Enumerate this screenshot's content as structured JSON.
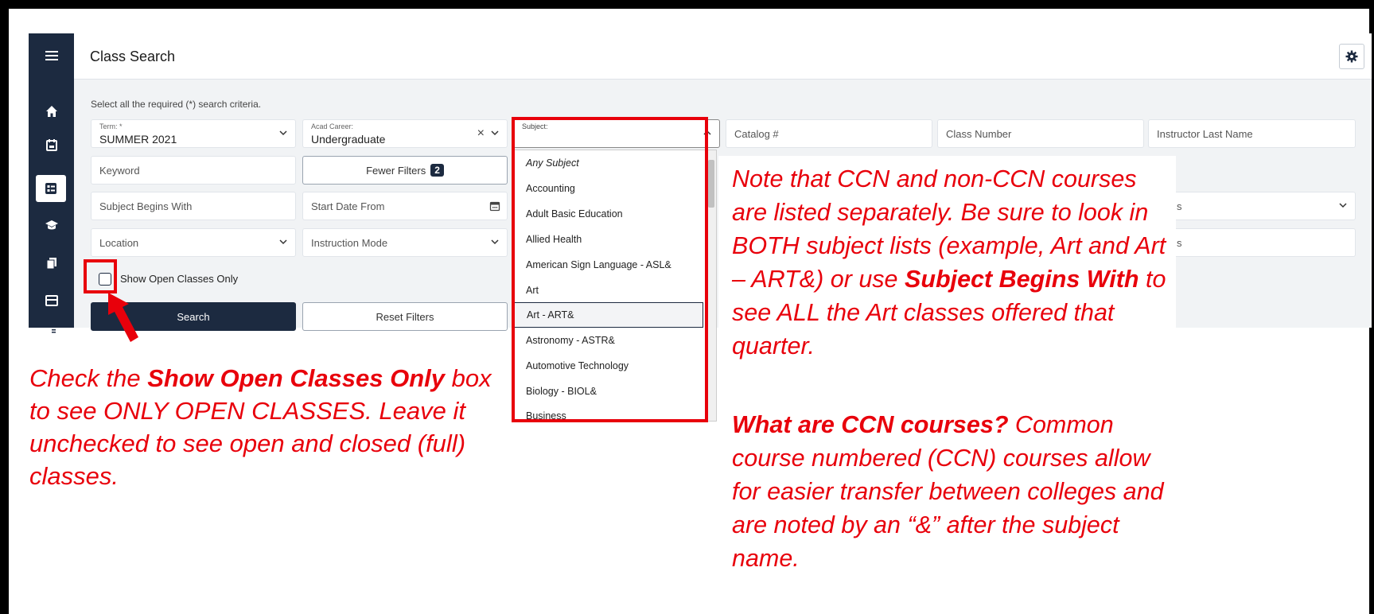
{
  "app": {
    "title": "Class Search",
    "hint": "Select all the required (*) search criteria."
  },
  "sidebar": {
    "icons": [
      "menu-icon",
      "home-icon",
      "calendar-icon",
      "class-search-icon",
      "graduation-cap-icon",
      "copy-icon",
      "card-icon",
      "catalog-icon"
    ]
  },
  "filters": {
    "term_label": "Term: *",
    "term_value": "SUMMER 2021",
    "career_label": "Acad Career:",
    "career_value": "Undergraduate",
    "subject_label": "Subject:",
    "catalog_placeholder": "Catalog #",
    "class_number_placeholder": "Class Number",
    "instructor_placeholder": "Instructor Last Name",
    "keyword_placeholder": "Keyword",
    "fewer_filters_label": "Fewer Filters",
    "fewer_filters_count": "2",
    "subject_begins_placeholder": "Subject Begins With",
    "start_date_placeholder": "Start Date From",
    "location_placeholder": "Location",
    "instruction_mode_placeholder": "Instruction Mode",
    "hidden_field_a_tail": "s",
    "hidden_field_b_tail": "s",
    "open_classes_label": "Show Open Classes Only",
    "search_label": "Search",
    "reset_label": "Reset Filters"
  },
  "subject_options": [
    "Any Subject",
    "Accounting",
    "Adult Basic Education",
    "Allied Health",
    "American Sign Language - ASL&",
    "Art",
    "Art - ART&",
    "Astronomy - ASTR&",
    "Automotive Technology",
    "Biology - BIOL&",
    "Business"
  ],
  "annotations": {
    "left": {
      "p1": "Check the ",
      "b1": "Show Open Classes Only",
      "p2": " box to see ONLY OPEN CLASSES. Leave it unchecked to see open and closed (full) classes."
    },
    "right": {
      "p1": "Note that CCN and non-CCN courses are listed separately. Be sure to look in BOTH subject lists (example, Art and Art – ART&) or use ",
      "b1": "Subject Begins With",
      "p2": " to see ALL the Art classes offered that quarter.",
      "b2": "What are CCN courses?",
      "p3": " Common course numbered (CCN) courses allow for easier transfer between colleges and are noted by an “&” after the subject name."
    }
  },
  "colors": {
    "annotation_red": "#e8000b",
    "navy": "#1c2a40"
  }
}
